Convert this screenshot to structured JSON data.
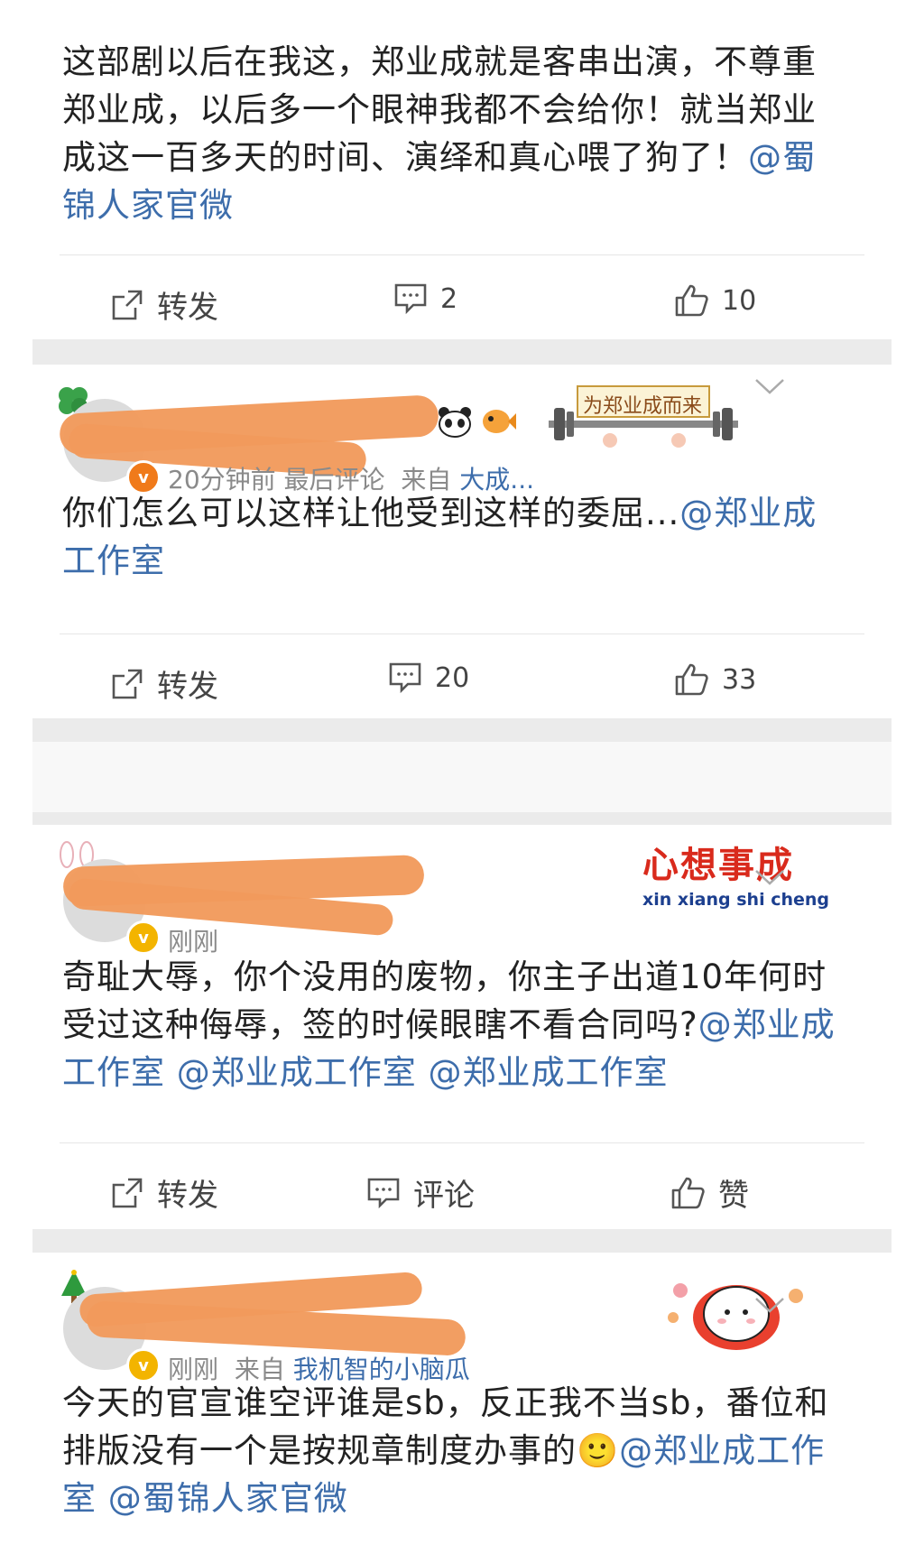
{
  "post1": {
    "text_lines": [
      "这部剧以后在我这，郑业成就是客串出演，不尊重",
      "郑业成，以后多一个眼神我都不会给你！就当郑业",
      "成这一百多天的时间、演绎和真心喂了狗了！"
    ],
    "mention_tail": "@蜀",
    "mention_line": "锦人家官微",
    "repost_label": "转发",
    "comment_count": "2",
    "like_count": "10"
  },
  "post2": {
    "time": "20分钟前",
    "last_comment": "最后评论",
    "from_label": "来自",
    "source": "大成...",
    "sticker_text": "为郑业成而来",
    "text_main": "你们怎么可以这样让他受到这样的委屈...",
    "mention_a": "@郑业成",
    "mention_b": "工作室",
    "repost_label": "转发",
    "comment_count": "20",
    "like_count": "33"
  },
  "post3": {
    "time": "刚刚",
    "sticker_title": "心想事成",
    "sticker_sub": "xin xiang shi cheng",
    "line1": "奇耻大辱，你个没用的废物，你主子出道10年何时",
    "line2_plain": "受过这种侮辱，签的时候眼瞎不看合同吗?",
    "line2_mention": "@郑业成",
    "line3": "工作室 @郑业成工作室 @郑业成工作室",
    "repost_label": "转发",
    "comment_label": "评论",
    "like_label": "赞"
  },
  "post4": {
    "time": "刚刚",
    "from_label": "来自",
    "source": "我机智的小脑瓜",
    "line1": "今天的官宣谁空评谁是sb，反正我不当sb，番位和",
    "line2_plain": "排版没有一个是按规章制度办事的",
    "emoji": "🙂",
    "line2_mention": "@郑业成工作",
    "line3": "室 @蜀锦人家官微"
  },
  "colors": {
    "mention": "#3d6dab",
    "separator": "#ebebeb",
    "scribble": "#f19a5c",
    "badge_orange": "#f07a1a",
    "badge_yellow": "#f3b400"
  }
}
